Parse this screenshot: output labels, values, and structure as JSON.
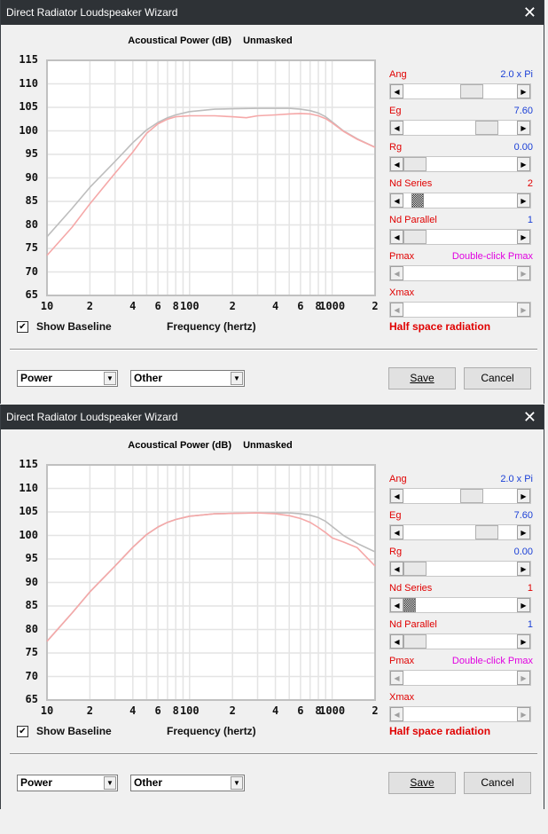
{
  "windows": [
    {
      "title": "Direct Radiator Loudspeaker Wizard",
      "chart_title": [
        "Acoustical Power (dB)",
        "Unmasked"
      ],
      "show_baseline_label": "Show Baseline",
      "show_baseline_checked": true,
      "x_axis_label": "Frequency (hertz)",
      "radiation_label": "Half space radiation",
      "controls": [
        {
          "label": "Ang",
          "value": "2.0 x Pi",
          "value_color": "#1a3fd6",
          "position": 0.62,
          "thumb": "normal",
          "enabled": true
        },
        {
          "label": "Eg",
          "value": "7.60",
          "value_color": "#1a3fd6",
          "position": 0.78,
          "thumb": "normal",
          "enabled": true
        },
        {
          "label": "Rg",
          "value": "0.00",
          "value_color": "#1a3fd6",
          "position": 0.0,
          "thumb": "normal",
          "enabled": true
        },
        {
          "label": "Nd  Series",
          "value": "2",
          "value_color": "#e00000",
          "position": 0.08,
          "thumb": "hatch",
          "enabled": true
        },
        {
          "label": "Nd  Parallel",
          "value": "1",
          "value_color": "#1a3fd6",
          "position": 0.0,
          "thumb": "normal",
          "enabled": true
        },
        {
          "label": "Pmax",
          "value": "Double-click Pmax",
          "value_color": "#e000e0",
          "position": null,
          "enabled": false
        },
        {
          "label": "Xmax",
          "value": "",
          "value_color": "#1a3fd6",
          "position": null,
          "enabled": false
        }
      ],
      "combo1": "Power",
      "combo2": "Other",
      "save_label": "Save",
      "cancel_label": "Cancel"
    },
    {
      "title": "Direct Radiator Loudspeaker Wizard",
      "chart_title": [
        "Acoustical Power (dB)",
        "Unmasked"
      ],
      "show_baseline_label": "Show Baseline",
      "show_baseline_checked": true,
      "x_axis_label": "Frequency (hertz)",
      "radiation_label": "Half space radiation",
      "controls": [
        {
          "label": "Ang",
          "value": "2.0 x Pi",
          "value_color": "#1a3fd6",
          "position": 0.62,
          "thumb": "normal",
          "enabled": true
        },
        {
          "label": "Eg",
          "value": "7.60",
          "value_color": "#1a3fd6",
          "position": 0.78,
          "thumb": "normal",
          "enabled": true
        },
        {
          "label": "Rg",
          "value": "0.00",
          "value_color": "#1a3fd6",
          "position": 0.0,
          "thumb": "normal",
          "enabled": true
        },
        {
          "label": "Nd  Series",
          "value": "1",
          "value_color": "#e00000",
          "position": 0.0,
          "thumb": "hatch",
          "enabled": true
        },
        {
          "label": "Nd  Parallel",
          "value": "1",
          "value_color": "#1a3fd6",
          "position": 0.0,
          "thumb": "normal",
          "enabled": true
        },
        {
          "label": "Pmax",
          "value": "Double-click Pmax",
          "value_color": "#e000e0",
          "position": null,
          "enabled": false
        },
        {
          "label": "Xmax",
          "value": "",
          "value_color": "#1a3fd6",
          "position": null,
          "enabled": false
        }
      ],
      "combo1": "Power",
      "combo2": "Other",
      "save_label": "Save",
      "cancel_label": "Cancel"
    }
  ],
  "colors": {
    "baseline": "#bdbdbd",
    "current": "#f5a8a8",
    "grid": "#e4e4e4",
    "frame": "#c0c0c0"
  },
  "chart_data": [
    {
      "type": "line",
      "title": "Acoustical Power (dB)  Unmasked",
      "xlabel": "Frequency (hertz)",
      "ylabel": "",
      "xscale": "log",
      "xlim": [
        10,
        2000
      ],
      "ylim": [
        65,
        115
      ],
      "yticks": [
        115,
        110,
        105,
        100,
        95,
        90,
        85,
        80,
        75,
        70,
        65
      ],
      "xtick_labels": [
        {
          "f": 10,
          "t": "10"
        },
        {
          "f": 20,
          "t": "2"
        },
        {
          "f": 40,
          "t": "4"
        },
        {
          "f": 60,
          "t": "6"
        },
        {
          "f": 80,
          "t": "8"
        },
        {
          "f": 100,
          "t": "100"
        },
        {
          "f": 200,
          "t": "2"
        },
        {
          "f": 400,
          "t": "4"
        },
        {
          "f": 600,
          "t": "6"
        },
        {
          "f": 800,
          "t": "8"
        },
        {
          "f": 1000,
          "t": "1000"
        },
        {
          "f": 2000,
          "t": "2"
        }
      ],
      "grid": true,
      "series": [
        {
          "name": "Baseline",
          "x": [
            10,
            15,
            20,
            30,
            40,
            50,
            60,
            70,
            80,
            100,
            150,
            200,
            300,
            400,
            500,
            600,
            700,
            800,
            900,
            1000,
            1200,
            1500,
            2000
          ],
          "y": [
            77.5,
            83.5,
            88,
            93.5,
            97.5,
            100.2,
            101.8,
            102.8,
            103.4,
            104.1,
            104.6,
            104.7,
            104.8,
            104.8,
            104.8,
            104.6,
            104.3,
            103.8,
            103.0,
            101.9,
            100.0,
            98.3,
            96.5
          ]
        },
        {
          "name": "Current",
          "x": [
            10,
            15,
            20,
            30,
            40,
            50,
            60,
            70,
            80,
            100,
            150,
            200,
            250,
            300,
            400,
            500,
            600,
            700,
            800,
            900,
            1000,
            1200,
            1500,
            2000
          ],
          "y": [
            73.5,
            79.5,
            84.5,
            91,
            95.5,
            99.5,
            101.5,
            102.5,
            103.0,
            103.2,
            103.2,
            103.0,
            102.8,
            103.2,
            103.4,
            103.6,
            103.7,
            103.6,
            103.2,
            102.6,
            101.7,
            99.9,
            98.2,
            96.5
          ]
        }
      ]
    },
    {
      "type": "line",
      "title": "Acoustical Power (dB)  Unmasked",
      "xlabel": "Frequency (hertz)",
      "ylabel": "",
      "xscale": "log",
      "xlim": [
        10,
        2000
      ],
      "ylim": [
        65,
        115
      ],
      "yticks": [
        115,
        110,
        105,
        100,
        95,
        90,
        85,
        80,
        75,
        70,
        65
      ],
      "xtick_labels": [
        {
          "f": 10,
          "t": "10"
        },
        {
          "f": 20,
          "t": "2"
        },
        {
          "f": 40,
          "t": "4"
        },
        {
          "f": 60,
          "t": "6"
        },
        {
          "f": 80,
          "t": "8"
        },
        {
          "f": 100,
          "t": "100"
        },
        {
          "f": 200,
          "t": "2"
        },
        {
          "f": 400,
          "t": "4"
        },
        {
          "f": 600,
          "t": "6"
        },
        {
          "f": 800,
          "t": "8"
        },
        {
          "f": 1000,
          "t": "1000"
        },
        {
          "f": 2000,
          "t": "2"
        }
      ],
      "grid": true,
      "series": [
        {
          "name": "Baseline",
          "x": [
            10,
            15,
            20,
            30,
            40,
            50,
            60,
            70,
            80,
            100,
            150,
            200,
            300,
            400,
            500,
            600,
            700,
            800,
            900,
            1000,
            1200,
            1500,
            2000
          ],
          "y": [
            77.5,
            83.5,
            88,
            93.5,
            97.5,
            100.2,
            101.8,
            102.8,
            103.4,
            104.1,
            104.6,
            104.7,
            104.8,
            104.8,
            104.8,
            104.6,
            104.3,
            103.8,
            103.0,
            101.9,
            100.0,
            98.3,
            96.5
          ]
        },
        {
          "name": "Current",
          "x": [
            10,
            15,
            20,
            30,
            40,
            50,
            60,
            70,
            80,
            100,
            150,
            200,
            300,
            400,
            500,
            600,
            700,
            800,
            900,
            1000,
            1200,
            1500,
            2000
          ],
          "y": [
            77.5,
            83.5,
            88,
            93.5,
            97.5,
            100.2,
            101.8,
            102.8,
            103.4,
            104.1,
            104.6,
            104.7,
            104.8,
            104.6,
            104.2,
            103.6,
            102.8,
            101.7,
            100.6,
            99.5,
            98.6,
            97.4,
            93.5
          ]
        }
      ]
    }
  ]
}
